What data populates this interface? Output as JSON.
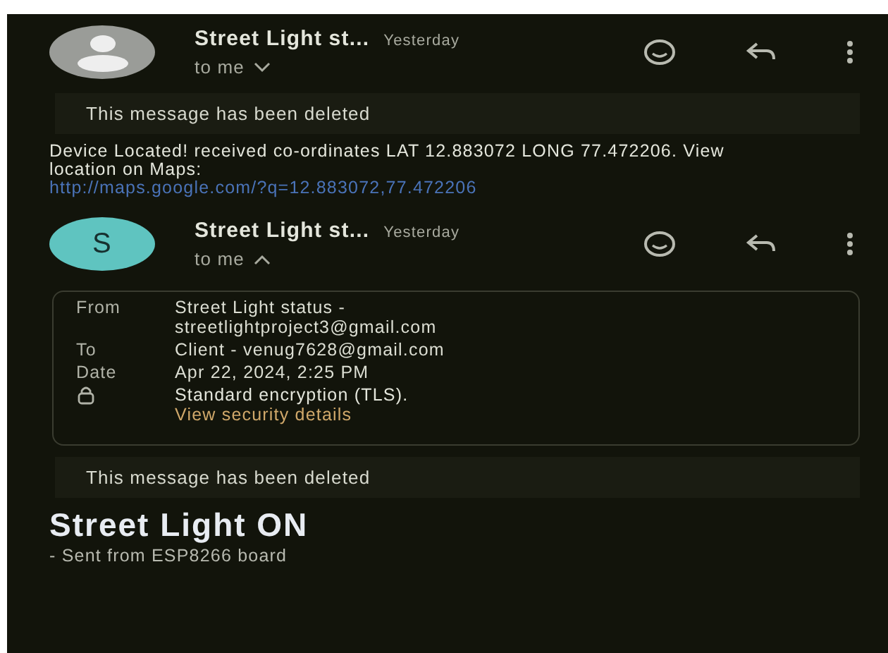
{
  "messages": [
    {
      "avatar": {
        "kind": "silhouette"
      },
      "sender": "Street Light st...",
      "time": "Yesterday",
      "recipient": "to me",
      "expanded": false,
      "notice": "This message has been deleted",
      "body": "Device Located! received co-ordinates LAT 12.883072 LONG 77.472206. View location on Maps:",
      "link": "http://maps.google.com/?q=12.883072,77.472206"
    },
    {
      "avatar": {
        "kind": "letter",
        "letter": "S"
      },
      "sender": "Street Light st...",
      "time": "Yesterday",
      "recipient": "to me",
      "expanded": true,
      "details": [
        {
          "kind": "field",
          "label": "From",
          "value": "Street Light status - streetlightproject3@gmail.com"
        },
        {
          "kind": "field",
          "label": "To",
          "value": "Client - venug7628@gmail.com"
        },
        {
          "kind": "field",
          "label": "Date",
          "value": "Apr 22, 2024, 2:25 PM"
        },
        {
          "kind": "security",
          "value": "Standard encryption (TLS).",
          "link": "View security details"
        }
      ],
      "notice": "This message has been deleted",
      "heading": "Street Light ON",
      "signature": "- Sent from ESP8266 board"
    }
  ]
}
